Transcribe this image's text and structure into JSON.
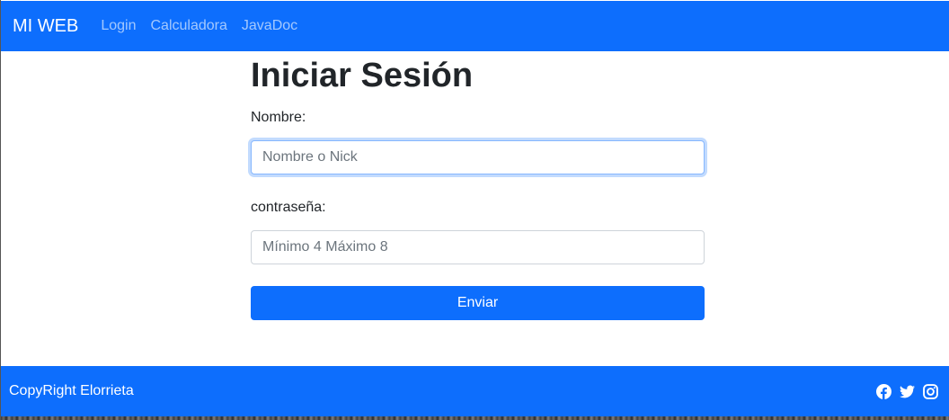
{
  "navbar": {
    "brand": "MI WEB",
    "links": [
      "Login",
      "Calculadora",
      "JavaDoc"
    ]
  },
  "form": {
    "title": "Iniciar Sesión",
    "name_label": "Nombre:",
    "name_placeholder": "Nombre o Nick",
    "password_label": "contraseña:",
    "password_placeholder": "Mínimo 4 Máximo 8",
    "submit_label": "Enviar"
  },
  "footer": {
    "copyright": "CopyRight Elorrieta",
    "social_icons": [
      "facebook-icon",
      "twitter-icon",
      "instagram-icon"
    ]
  },
  "colors": {
    "primary": "#0d6efd",
    "text": "#212529",
    "nav_link": "rgba(255,255,255,0.62)"
  }
}
